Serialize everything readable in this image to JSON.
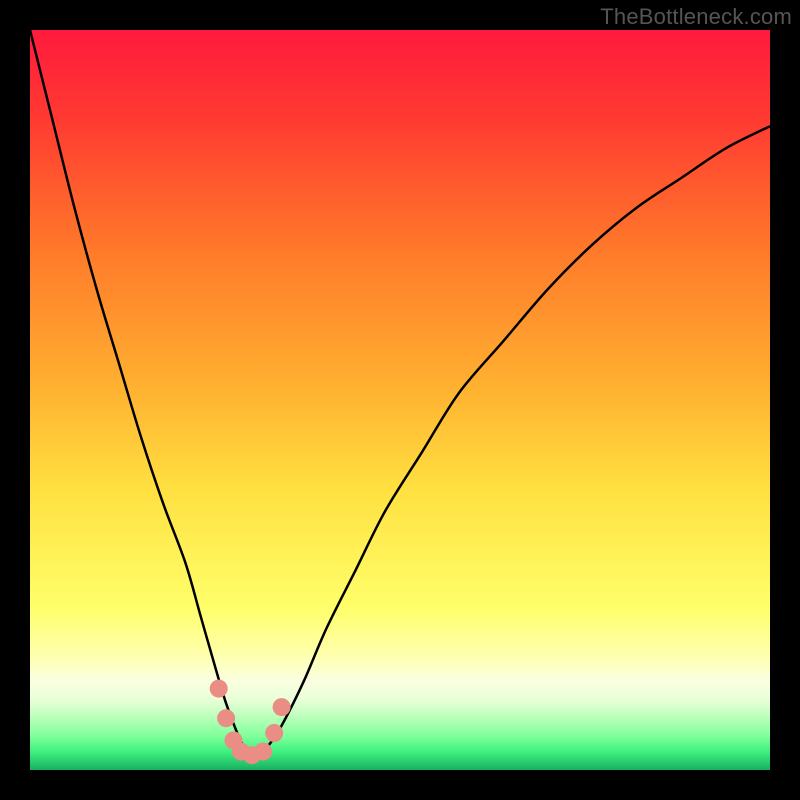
{
  "watermark": "TheBottleneck.com",
  "chart_data": {
    "type": "line",
    "title": "",
    "xlabel": "",
    "ylabel": "",
    "xlim": [
      0,
      100
    ],
    "ylim": [
      0,
      100
    ],
    "gradient_stops": [
      {
        "offset": 0.0,
        "color": "#ff1a3d"
      },
      {
        "offset": 0.12,
        "color": "#ff3a32"
      },
      {
        "offset": 0.3,
        "color": "#ff7a2a"
      },
      {
        "offset": 0.48,
        "color": "#ffb030"
      },
      {
        "offset": 0.62,
        "color": "#ffe040"
      },
      {
        "offset": 0.78,
        "color": "#ffff6a"
      },
      {
        "offset": 0.84,
        "color": "#ffffa8"
      },
      {
        "offset": 0.88,
        "color": "#faffe0"
      },
      {
        "offset": 0.905,
        "color": "#e8ffd8"
      },
      {
        "offset": 0.93,
        "color": "#b8ffb8"
      },
      {
        "offset": 0.955,
        "color": "#7dff9a"
      },
      {
        "offset": 0.975,
        "color": "#40f080"
      },
      {
        "offset": 1.0,
        "color": "#18b060"
      }
    ],
    "series": [
      {
        "name": "bottleneck-curve",
        "x": [
          0,
          3,
          6,
          9,
          12,
          15,
          18,
          21,
          23,
          25,
          26.5,
          28,
          29,
          30,
          31,
          32,
          34,
          37,
          40,
          44,
          48,
          53,
          58,
          64,
          70,
          76,
          82,
          88,
          94,
          100
        ],
        "values": [
          100,
          88,
          76,
          65,
          55,
          45,
          36,
          28,
          21,
          14,
          9,
          5,
          3,
          2,
          2,
          3,
          6,
          12,
          19,
          27,
          35,
          43,
          51,
          58,
          65,
          71,
          76,
          80,
          84,
          87
        ]
      }
    ],
    "markers": {
      "name": "highlight-points",
      "color": "#e98d85",
      "points": [
        {
          "x": 25.5,
          "y": 11
        },
        {
          "x": 26.5,
          "y": 7
        },
        {
          "x": 27.5,
          "y": 4
        },
        {
          "x": 28.5,
          "y": 2.5
        },
        {
          "x": 30.0,
          "y": 2
        },
        {
          "x": 31.5,
          "y": 2.5
        },
        {
          "x": 33.0,
          "y": 5
        },
        {
          "x": 34.0,
          "y": 8.5
        }
      ]
    }
  }
}
